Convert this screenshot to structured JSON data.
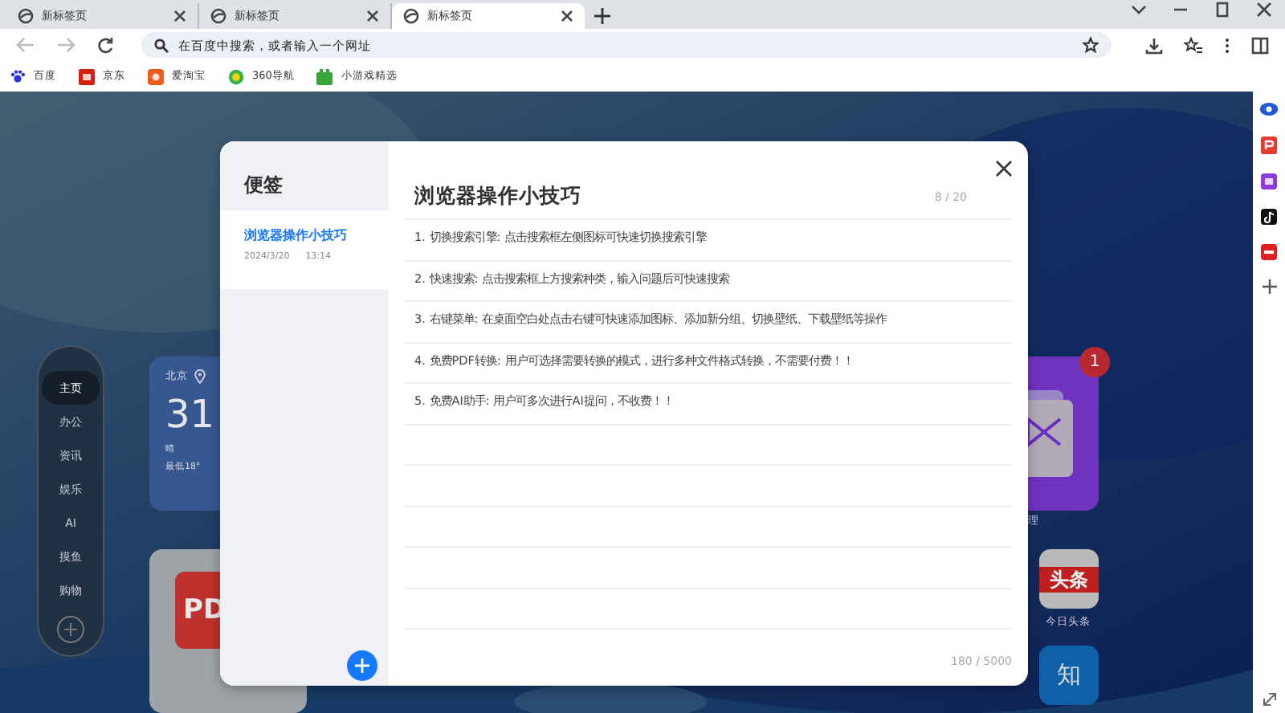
{
  "browser_tabs": [
    {
      "title": "新标签页",
      "selected": false
    },
    {
      "title": "新标签页",
      "selected": false
    },
    {
      "title": "新标签页",
      "selected": true
    }
  ],
  "address_bar": {
    "placeholder": "在百度中搜索，或者输入一个网址"
  },
  "bookmarks": [
    {
      "kind": "paw",
      "label": "百度"
    },
    {
      "kind": "jd",
      "label": "京东"
    },
    {
      "kind": "taobao",
      "label": "爱淘宝"
    },
    {
      "kind": "nav360",
      "label": "360导航"
    },
    {
      "kind": "game",
      "label": "小游戏精选"
    }
  ],
  "category_nav": [
    {
      "label": "主页",
      "selected": true
    },
    {
      "label": "办公",
      "selected": false
    },
    {
      "label": "资讯",
      "selected": false
    },
    {
      "label": "娱乐",
      "selected": false
    },
    {
      "label": "AI",
      "selected": false
    },
    {
      "label": "摸鱼",
      "selected": false
    },
    {
      "label": "购物",
      "selected": false
    }
  ],
  "weather": {
    "city": "北京",
    "temperature": "31",
    "condition": "晴",
    "low": "最低18°"
  },
  "app_tiles": [
    {
      "kind": "pdf",
      "text": "PD"
    },
    {
      "kind": "folder",
      "label": "理",
      "badge": "1"
    },
    {
      "kind": "toutiao",
      "text": "头条",
      "label": "今日头条"
    },
    {
      "kind": "zhihu",
      "text": "知"
    }
  ],
  "notes_dialog": {
    "title": "便签",
    "notes": [
      {
        "title": "浏览器操作小技巧",
        "date": "2024/3/20",
        "time": "13:14",
        "selected": true
      }
    ],
    "editor": {
      "title": "浏览器操作小技巧",
      "title_count": "8 / 20",
      "lines": [
        "1. 切换搜索引擎: 点击搜索框左侧图标可快速切换搜索引擎",
        "2. 快速搜索: 点击搜索框上方搜索种类，输入问题后可快速搜索",
        "3. 右键菜单: 在桌面空白处点击右键可快速添加图标、添加新分组、切换壁纸、下载壁纸等操作",
        "4. 免费PDF转换: 用户可选择需要转换的模式，进行多种文件格式转换，不需要付费！！",
        "5. 免费AI助手: 用户可多次进行AI提问，不收费！！"
      ],
      "char_count": "180 / 5000"
    }
  }
}
